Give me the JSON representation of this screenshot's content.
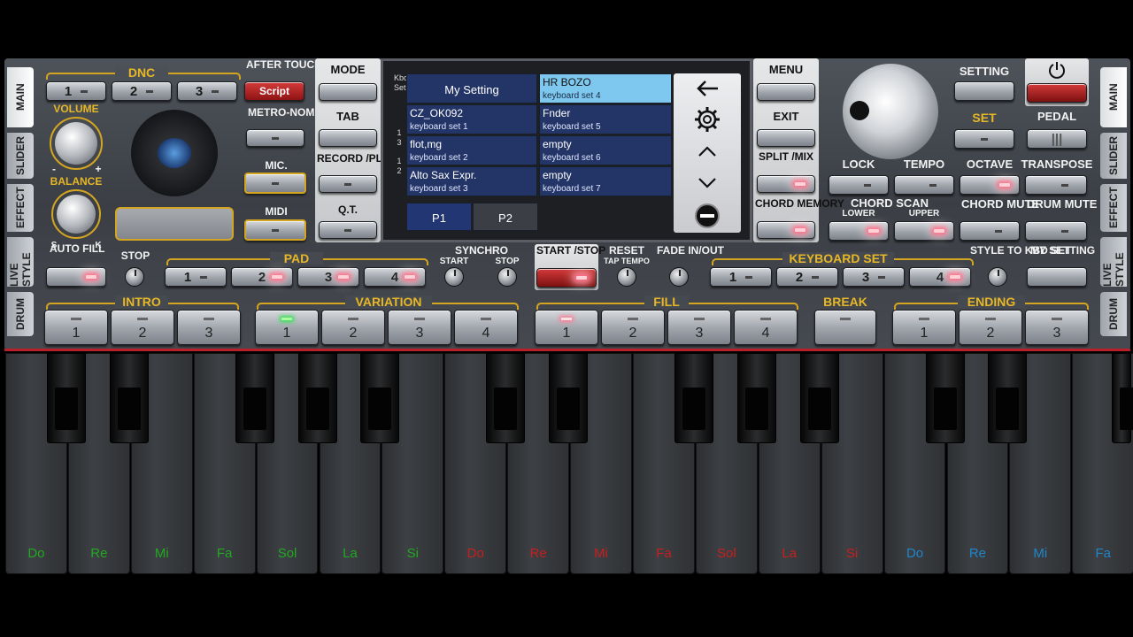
{
  "left_tabs": [
    "MAIN",
    "SLIDER",
    "EFFECT",
    "LIVE STYLE",
    "DRUM"
  ],
  "right_tabs": [
    "MAIN",
    "SLIDER",
    "EFFECT",
    "LIVE STYLE",
    "DRUM"
  ],
  "dnc": {
    "label": "DNC",
    "buttons": [
      "1",
      "2",
      "3"
    ],
    "script": "Script"
  },
  "after_touch": "AFTER TOUCH",
  "metronome": "METRO-NOME",
  "mic": "MIC.",
  "midi": "MIDI",
  "volume": "VOLUME",
  "balance": "BALANCE",
  "balance_minus": "-",
  "balance_plus": "+",
  "s_mark": "S",
  "k_mark": "K",
  "auto_fill": "AUTO FILL",
  "stop": "STOP",
  "pad": {
    "label": "PAD",
    "buttons": [
      "1",
      "2",
      "3",
      "4"
    ]
  },
  "mode": "MODE",
  "tab": "TAB",
  "record_play": "RECORD /PLAY",
  "qt": "Q.T.",
  "screen": {
    "side_letters": [
      "Kbd",
      "Set",
      "1",
      "3",
      "1",
      "2"
    ],
    "my_setting": "My Setting",
    "cells": [
      {
        "name": "HR BOZO",
        "sub": "keyboard set 4"
      },
      {
        "name": "CZ_OK092",
        "sub": "keyboard set 1"
      },
      {
        "name": "Fnder",
        "sub": "keyboard set 5"
      },
      {
        "name": "flot,mg",
        "sub": "keyboard set 2"
      },
      {
        "name": "empty",
        "sub": "keyboard set 6"
      },
      {
        "name": "Alto Sax Expr.",
        "sub": "keyboard set 3"
      },
      {
        "name": "empty",
        "sub": "keyboard set 7"
      }
    ],
    "pages": [
      "P1",
      "P2"
    ]
  },
  "menu": "MENU",
  "exit": "EXIT",
  "split_mix": "SPLIT /MIX",
  "chord_memory": "CHORD MEMORY",
  "setting": "SETTING",
  "set": "SET",
  "pedal": "PEDAL",
  "lock": "LOCK",
  "tempo": "TEMPO",
  "octave": "OCTAVE",
  "transpose": "TRANSPOSE",
  "chord_scan": "CHORD SCAN",
  "lower": "LOWER",
  "upper": "UPPER",
  "chord_mute": "CHORD MUTE",
  "drum_mute": "DRUM MUTE",
  "synchro": "SYNCHRO",
  "synchro_start": "START",
  "synchro_stop": "STOP",
  "start_stop": "START /STOP",
  "reset": "RESET",
  "tap_tempo": "TAP TEMPO",
  "fade": "FADE IN/OUT",
  "keyboard_set": {
    "label": "KEYBOARD SET",
    "buttons": [
      "1",
      "2",
      "3",
      "4"
    ]
  },
  "style_to_kbd": "STYLE TO KBD SET",
  "my_setting_btn": "MY SETTING",
  "intro": {
    "label": "INTRO",
    "buttons": [
      "1",
      "2",
      "3"
    ]
  },
  "variation": {
    "label": "VARIATION",
    "buttons": [
      "1",
      "2",
      "3",
      "4"
    ]
  },
  "fill": {
    "label": "FILL",
    "buttons": [
      "1",
      "2",
      "3",
      "4"
    ]
  },
  "break": "BREAK",
  "ending": {
    "label": "ENDING",
    "buttons": [
      "1",
      "2",
      "3"
    ]
  },
  "keys": [
    {
      "note": "Do",
      "color": "#22a822"
    },
    {
      "note": "Re",
      "color": "#22a822"
    },
    {
      "note": "Mi",
      "color": "#22a822"
    },
    {
      "note": "Fa",
      "color": "#22a822"
    },
    {
      "note": "Sol",
      "color": "#22a822"
    },
    {
      "note": "La",
      "color": "#22a822"
    },
    {
      "note": "Si",
      "color": "#22a822"
    },
    {
      "note": "Do",
      "color": "#c81e1e"
    },
    {
      "note": "Re",
      "color": "#c81e1e"
    },
    {
      "note": "Mi",
      "color": "#c81e1e"
    },
    {
      "note": "Fa",
      "color": "#c81e1e"
    },
    {
      "note": "Sol",
      "color": "#c81e1e"
    },
    {
      "note": "La",
      "color": "#c81e1e"
    },
    {
      "note": "Si",
      "color": "#c81e1e"
    },
    {
      "note": "Do",
      "color": "#1e86c8"
    },
    {
      "note": "Re",
      "color": "#1e86c8"
    },
    {
      "note": "Mi",
      "color": "#1e86c8"
    },
    {
      "note": "Fa",
      "color": "#1e86c8"
    }
  ],
  "colors": {
    "gold": "#e7b726",
    "accent_red": "#b8202a",
    "selection": "#7ec8f0",
    "cell": "#233466"
  }
}
